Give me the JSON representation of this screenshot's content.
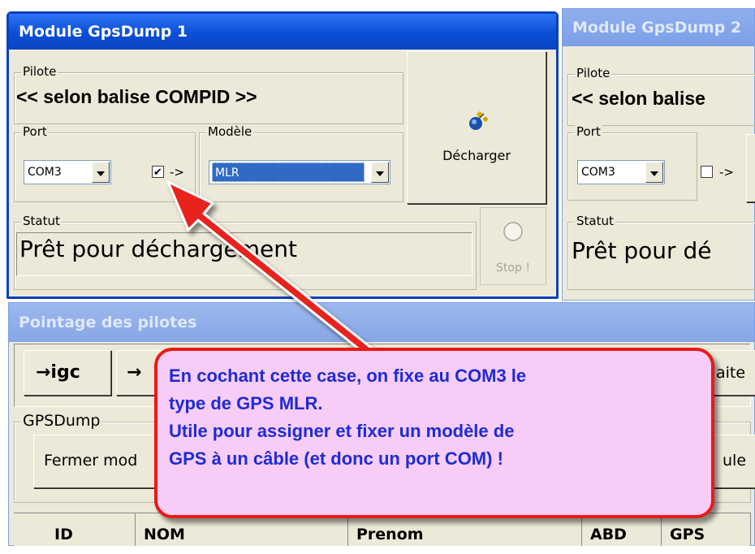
{
  "module1": {
    "title": "Module GpsDump 1",
    "pilote_label": "Pilote",
    "pilote_value": "<< selon balise COMPID >>",
    "port_label": "Port",
    "port_value": "COM3",
    "checkbox_checked": true,
    "checkbox_mark": "✔",
    "arrow_text": "->",
    "modele_label": "Modèle",
    "modele_value": "MLR",
    "download_label": "Décharger",
    "statut_label": "Statut",
    "statut_value": "Prêt pour déchargement",
    "stop_label": "Stop !"
  },
  "module2": {
    "title": "Module GpsDump 2",
    "pilote_label": "Pilote",
    "pilote_value": "<< selon balise",
    "port_label": "Port",
    "port_value": "COM3",
    "checkbox_checked": false,
    "arrow_text": "->",
    "statut_label": "Statut",
    "statut_value": "Prêt pour dé"
  },
  "pointage": {
    "title": "Pointage des pilotes",
    "btn_igc": "→igc",
    "btn_second": "→",
    "partial_right_btn": "aite",
    "gpsdump_label": "GPSDump",
    "fermer_btn": "Fermer mod",
    "partial_right_btn2": "ule",
    "columns": [
      "ID",
      "NOM",
      "Prenom",
      "ABD",
      "GPS"
    ]
  },
  "callout": {
    "lines": [
      "En cochant cette case, on fixe au COM3 le",
      "type de GPS MLR.",
      "Utile pour assigner et fixer  un modèle de",
      "GPS à un câble (et donc un port COM) !"
    ],
    "fill_color": "#f7ccf6",
    "border_color": "#e81b17",
    "text_color": "#1d2bd9"
  },
  "colors": {
    "titlebar_active": "#0b4ed6",
    "titlebar_inactive": "#7c9fe6",
    "selection": "#316ac5",
    "arrow": "#e8231a"
  },
  "icons": [
    "satellite-icon",
    "stop-circle-icon",
    "dropdown-arrow-icon",
    "red-arrow"
  ]
}
